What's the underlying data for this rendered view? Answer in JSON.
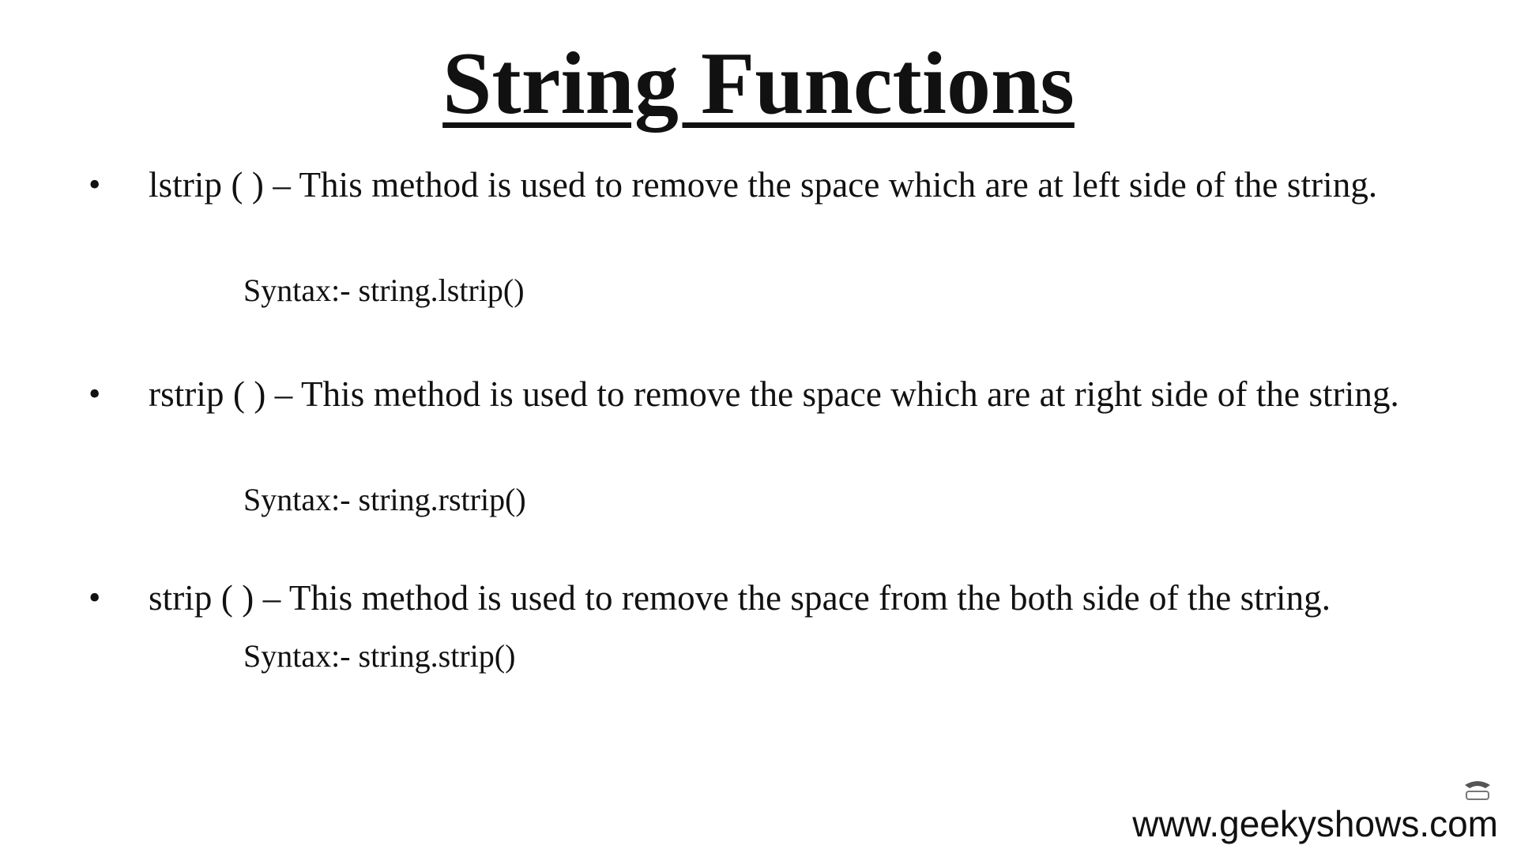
{
  "title": "String Functions",
  "items": [
    {
      "bullet": "•",
      "description": "lstrip ( ) – This method is used to remove the space which are at left side of the string.",
      "syntax": "Syntax:- string.lstrip()"
    },
    {
      "bullet": "•",
      "description": "rstrip ( ) – This method is used to remove the space which are at right side of the string.",
      "syntax": "Syntax:- string.rstrip()"
    },
    {
      "bullet": "•",
      "description": "strip ( ) – This method is used to remove the space from the both side of the string.",
      "syntax": "Syntax:- string.strip()"
    }
  ],
  "footer": {
    "url": "www.geekyshows.com"
  },
  "icons": {
    "logo": "geekyshows-logo-icon"
  }
}
